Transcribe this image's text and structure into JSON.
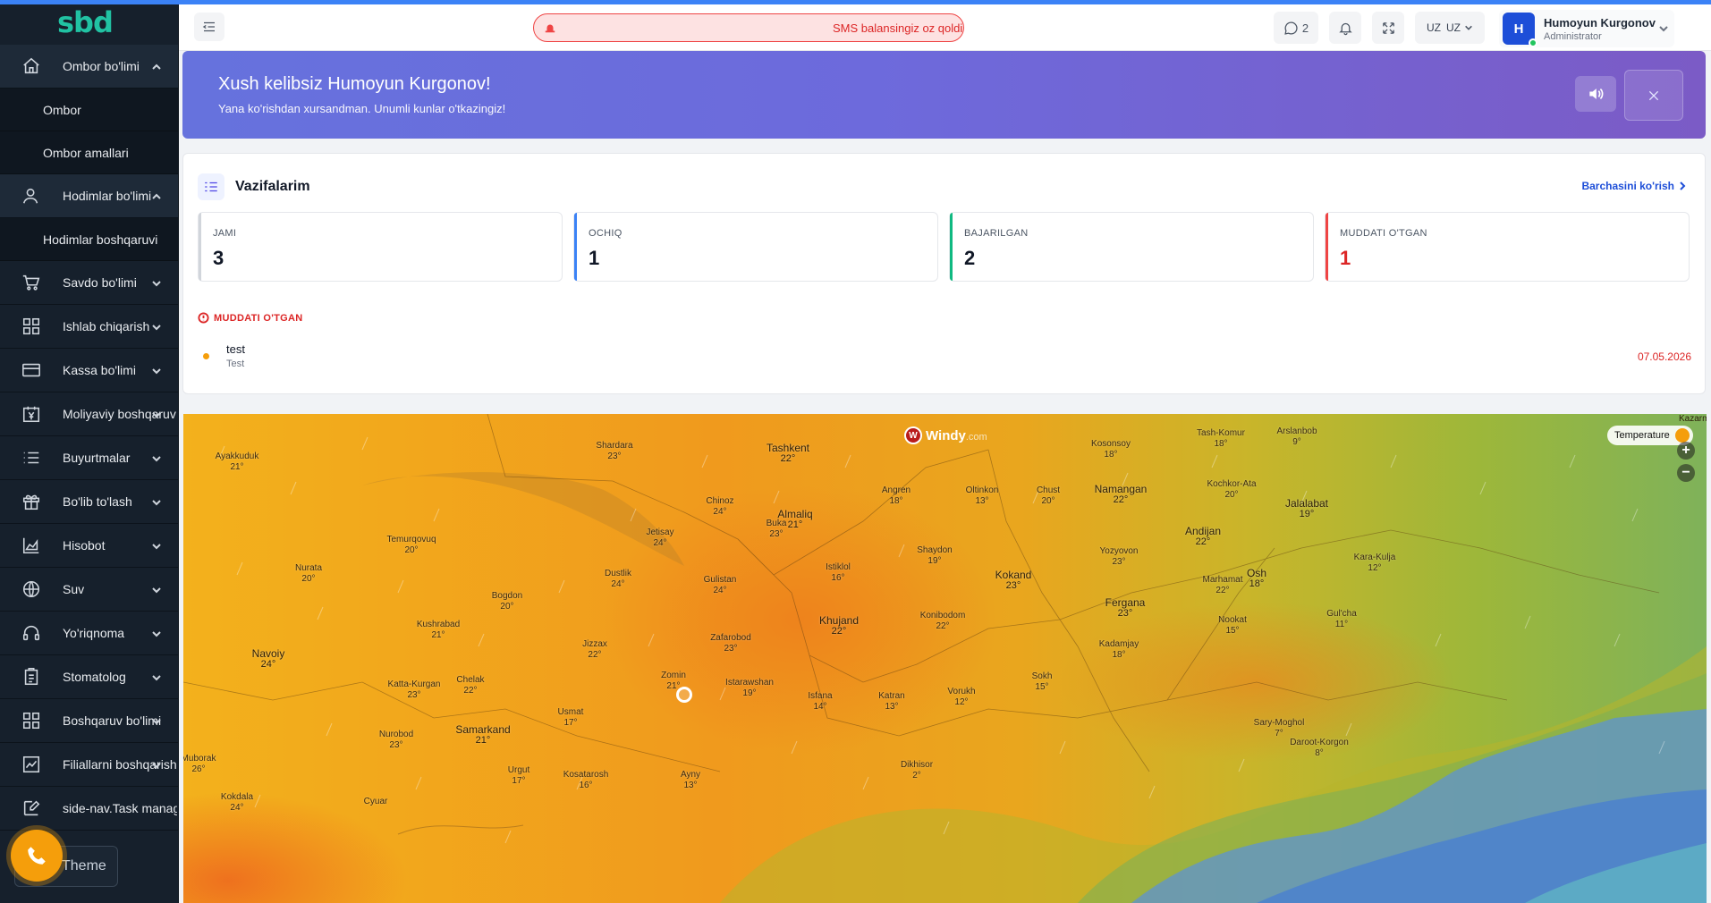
{
  "brand": {
    "logo_text": "sbd"
  },
  "sidebar": {
    "items": [
      {
        "label": "Ombor bo'limi",
        "expanded": true,
        "subitems": [
          "Ombor",
          "Ombor amallari"
        ]
      },
      {
        "label": "Hodimlar bo'limi",
        "expanded": true,
        "subitems": [
          "Hodimlar boshqaruvi"
        ]
      },
      {
        "label": "Savdo bo'limi"
      },
      {
        "label": "Ishlab chiqarish"
      },
      {
        "label": "Kassa bo'limi"
      },
      {
        "label": "Moliyaviy boshqaruv"
      },
      {
        "label": "Buyurtmalar"
      },
      {
        "label": "Bo'lib to'lash"
      },
      {
        "label": "Hisobot"
      },
      {
        "label": "Suv"
      },
      {
        "label": "Yo'riqnoma"
      },
      {
        "label": "Stomatolog"
      },
      {
        "label": "Boshqaruv bo'limi"
      },
      {
        "label": "Filiallarni boshqarish"
      },
      {
        "label": "side-nav.Task manager"
      }
    ],
    "theme_label": "Theme"
  },
  "header": {
    "sms_alert": "SMS balansingiz oz qoldi",
    "messages_count": "2",
    "language": "UZ",
    "user": {
      "initial": "H",
      "name": "Humoyun Kurgonov",
      "role": "Administrator"
    }
  },
  "welcome": {
    "title": "Xush kelibsiz Humoyun Kurgonov!",
    "subtitle": "Yana ko'rishdan xursandman. Unumli kunlar o'tkazingiz!"
  },
  "tasks": {
    "title": "Vazifalarim",
    "see_all": "Barchasini ko'rish",
    "stats": [
      {
        "label": "JAMI",
        "value": "3",
        "color": "#d1d5db"
      },
      {
        "label": "OCHIQ",
        "value": "1",
        "color": "#3b82f6"
      },
      {
        "label": "BAJARILGAN",
        "value": "2",
        "color": "#10b981"
      },
      {
        "label": "MUDDATI O'TGAN",
        "value": "1",
        "color": "#ef4444"
      }
    ],
    "overdue_heading": "MUDDATI O'TGAN",
    "overdue_items": [
      {
        "name": "test",
        "desc": "Test",
        "date": "07.05.2026"
      }
    ]
  },
  "map": {
    "brand": "Windy",
    "brand_suffix": ".com",
    "layer": "Temperature",
    "edge_label": "Kazarm",
    "zoom_in": "+",
    "zoom_out": "−",
    "cities": [
      {
        "name": "Ayakkuduk",
        "temp": "21°",
        "big": false
      },
      {
        "name": "Shardara",
        "temp": "23°",
        "big": false
      },
      {
        "name": "Tashkent",
        "temp": "22°",
        "big": true
      },
      {
        "name": "Kosonsoy",
        "temp": "18°",
        "big": false
      },
      {
        "name": "Tash-Komur",
        "temp": "18°",
        "big": false
      },
      {
        "name": "Arslanbob",
        "temp": "9°",
        "big": false
      },
      {
        "name": "Chinoz",
        "temp": "24°",
        "big": false
      },
      {
        "name": "Angren",
        "temp": "18°",
        "big": false
      },
      {
        "name": "Oltinkon",
        "temp": "13°",
        "big": false
      },
      {
        "name": "Chust",
        "temp": "20°",
        "big": false
      },
      {
        "name": "Namangan",
        "temp": "22°",
        "big": true
      },
      {
        "name": "Kochkor-Ata",
        "temp": "20°",
        "big": false
      },
      {
        "name": "Jalalabat",
        "temp": "19°",
        "big": true
      },
      {
        "name": "Almaliq",
        "temp": "21°",
        "big": true
      },
      {
        "name": "Buka",
        "temp": "23°",
        "big": false
      },
      {
        "name": "Jetisay",
        "temp": "24°",
        "big": false
      },
      {
        "name": "Temurqovuq",
        "temp": "20°",
        "big": false
      },
      {
        "name": "Nurata",
        "temp": "20°",
        "big": false
      },
      {
        "name": "Shaydon",
        "temp": "19°",
        "big": false
      },
      {
        "name": "Yozyovon",
        "temp": "23°",
        "big": false
      },
      {
        "name": "Andijan",
        "temp": "22°",
        "big": true
      },
      {
        "name": "Kara-Kulja",
        "temp": "12°",
        "big": false
      },
      {
        "name": "Dustlik",
        "temp": "24°",
        "big": false
      },
      {
        "name": "Istiklol",
        "temp": "16°",
        "big": false
      },
      {
        "name": "Kokand",
        "temp": "23°",
        "big": true
      },
      {
        "name": "Osh",
        "temp": "18°",
        "big": true
      },
      {
        "name": "Bogdon",
        "temp": "20°",
        "big": false
      },
      {
        "name": "Gulistan",
        "temp": "24°",
        "big": false
      },
      {
        "name": "Marhamat",
        "temp": "22°",
        "big": false
      },
      {
        "name": "Fergana",
        "temp": "23°",
        "big": true
      },
      {
        "name": "Kushrabad",
        "temp": "21°",
        "big": false
      },
      {
        "name": "Khujand",
        "temp": "22°",
        "big": true
      },
      {
        "name": "Konibodom",
        "temp": "22°",
        "big": false
      },
      {
        "name": "Nookat",
        "temp": "15°",
        "big": false
      },
      {
        "name": "Gul'cha",
        "temp": "11°",
        "big": false
      },
      {
        "name": "Navoiy",
        "temp": "24°",
        "big": true
      },
      {
        "name": "Jizzax",
        "temp": "22°",
        "big": false
      },
      {
        "name": "Zafarobod",
        "temp": "23°",
        "big": false
      },
      {
        "name": "Kadamjay",
        "temp": "18°",
        "big": false
      },
      {
        "name": "Zomin",
        "temp": "21°",
        "big": false
      },
      {
        "name": "Chelak",
        "temp": "22°",
        "big": false
      },
      {
        "name": "Katta-Kurgan",
        "temp": "23°",
        "big": false
      },
      {
        "name": "Istarawshan",
        "temp": "19°",
        "big": false
      },
      {
        "name": "Sokh",
        "temp": "15°",
        "big": false
      },
      {
        "name": "Isfana",
        "temp": "14°",
        "big": false
      },
      {
        "name": "Katran",
        "temp": "13°",
        "big": false
      },
      {
        "name": "Vorukh",
        "temp": "12°",
        "big": false
      },
      {
        "name": "Usmat",
        "temp": "17°",
        "big": false
      },
      {
        "name": "Sary-Moghol",
        "temp": "7°",
        "big": false
      },
      {
        "name": "Samarkand",
        "temp": "21°",
        "big": true
      },
      {
        "name": "Nurobod",
        "temp": "23°",
        "big": false
      },
      {
        "name": "Daroot-Korgon",
        "temp": "8°",
        "big": false
      },
      {
        "name": "Dikhisor",
        "temp": "2°",
        "big": false
      },
      {
        "name": "Urgut",
        "temp": "17°",
        "big": false
      },
      {
        "name": "Kosatarosh",
        "temp": "16°",
        "big": false
      },
      {
        "name": "Ayny",
        "temp": "13°",
        "big": false
      },
      {
        "name": "Muborak",
        "temp": "26°",
        "big": false
      },
      {
        "name": "Kokdala",
        "temp": "24°",
        "big": false
      },
      {
        "name": "Cyuar",
        "temp": "",
        "big": false
      }
    ]
  }
}
